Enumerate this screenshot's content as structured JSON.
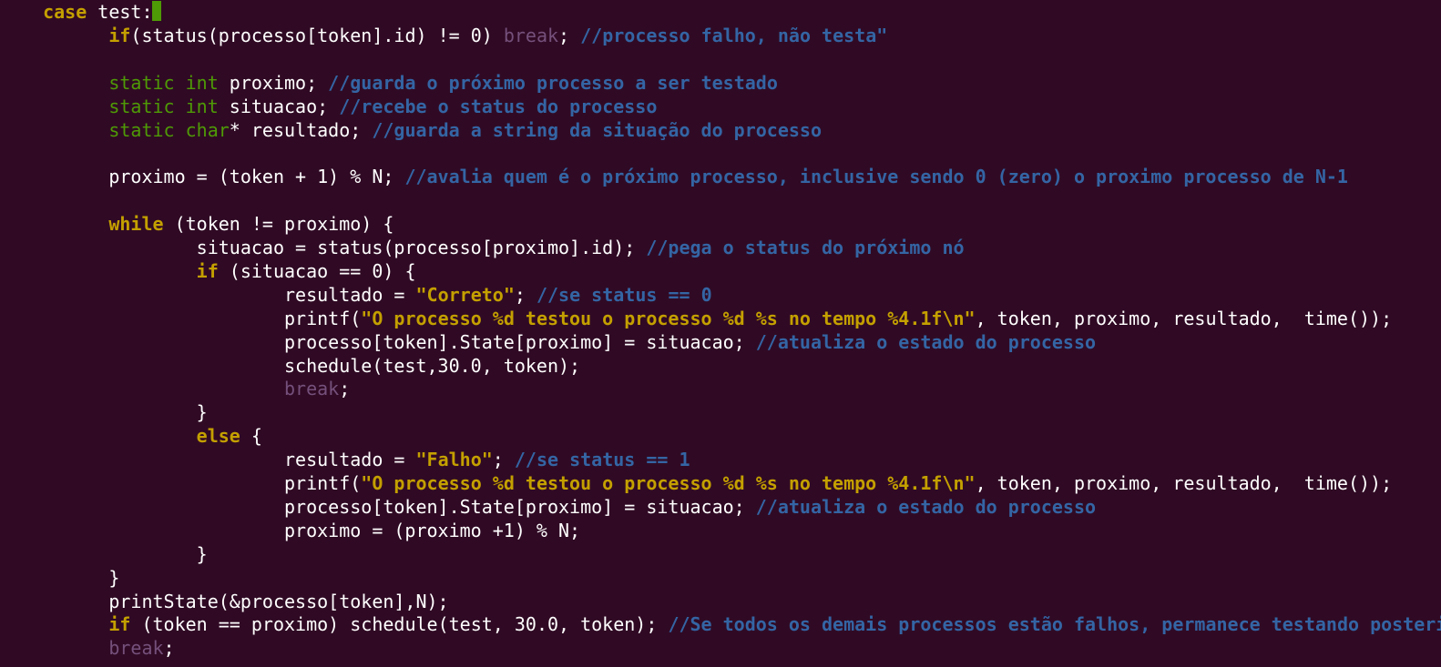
{
  "editor": {
    "lines": [
      {
        "tokens": [
          {
            "type": "plain",
            "text": "  "
          },
          {
            "type": "keyword",
            "text": "case"
          },
          {
            "type": "plain",
            "text": " test:"
          }
        ]
      },
      {
        "tokens": [
          {
            "type": "plain",
            "text": "        "
          },
          {
            "type": "keyword",
            "text": "if"
          },
          {
            "type": "plain",
            "text": "(status(processo[token].id) != 0) "
          },
          {
            "type": "break",
            "text": "break"
          },
          {
            "type": "plain",
            "text": "; "
          },
          {
            "type": "comment",
            "text": "//processo falho, não testa\""
          }
        ]
      },
      {
        "tokens": []
      },
      {
        "tokens": [
          {
            "type": "plain",
            "text": "        "
          },
          {
            "type": "type",
            "text": "static int"
          },
          {
            "type": "plain",
            "text": " proximo; "
          },
          {
            "type": "comment",
            "text": "//guarda o próximo processo a ser testado"
          }
        ]
      },
      {
        "tokens": [
          {
            "type": "plain",
            "text": "        "
          },
          {
            "type": "type",
            "text": "static int"
          },
          {
            "type": "plain",
            "text": " situacao; "
          },
          {
            "type": "comment",
            "text": "//recebe o status do processo"
          }
        ]
      },
      {
        "tokens": [
          {
            "type": "plain",
            "text": "        "
          },
          {
            "type": "type",
            "text": "static char"
          },
          {
            "type": "plain",
            "text": "* resultado; "
          },
          {
            "type": "comment",
            "text": "//guarda a string da situação do processo"
          }
        ]
      },
      {
        "tokens": []
      },
      {
        "tokens": [
          {
            "type": "plain",
            "text": "        proximo = (token + 1) % N; "
          },
          {
            "type": "comment",
            "text": "//avalia quem é o próximo processo, inclusive sendo 0 (zero) o proximo processo de N-1"
          }
        ]
      },
      {
        "tokens": []
      },
      {
        "tokens": [
          {
            "type": "plain",
            "text": "        "
          },
          {
            "type": "keyword",
            "text": "while"
          },
          {
            "type": "plain",
            "text": " (token != proximo) {"
          }
        ]
      },
      {
        "tokens": [
          {
            "type": "plain",
            "text": "                situacao = status(processo[proximo].id); "
          },
          {
            "type": "comment",
            "text": "//pega o status do próximo nó"
          }
        ]
      },
      {
        "tokens": [
          {
            "type": "plain",
            "text": "                "
          },
          {
            "type": "keyword",
            "text": "if"
          },
          {
            "type": "plain",
            "text": " (situacao == 0) {"
          }
        ]
      },
      {
        "tokens": [
          {
            "type": "plain",
            "text": "                        resultado = "
          },
          {
            "type": "string",
            "text": "\"Correto\""
          },
          {
            "type": "plain",
            "text": "; "
          },
          {
            "type": "comment",
            "text": "//se status == 0"
          }
        ]
      },
      {
        "tokens": [
          {
            "type": "plain",
            "text": "                        printf("
          },
          {
            "type": "string",
            "text": "\"O processo %d testou o processo %d %s no tempo %4.1f\\n\""
          },
          {
            "type": "plain",
            "text": ", token, proximo, resultado,  time());"
          }
        ]
      },
      {
        "tokens": [
          {
            "type": "plain",
            "text": "                        processo[token].State[proximo] = situacao; "
          },
          {
            "type": "comment",
            "text": "//atualiza o estado do processo"
          }
        ]
      },
      {
        "tokens": [
          {
            "type": "plain",
            "text": "                        schedule(test,30.0, token);"
          }
        ]
      },
      {
        "tokens": [
          {
            "type": "plain",
            "text": "                        "
          },
          {
            "type": "break",
            "text": "break"
          },
          {
            "type": "plain",
            "text": ";"
          }
        ]
      },
      {
        "tokens": [
          {
            "type": "plain",
            "text": "                }"
          }
        ]
      },
      {
        "tokens": [
          {
            "type": "plain",
            "text": "                "
          },
          {
            "type": "keyword",
            "text": "else"
          },
          {
            "type": "plain",
            "text": " {"
          }
        ]
      },
      {
        "tokens": [
          {
            "type": "plain",
            "text": "                        resultado = "
          },
          {
            "type": "string",
            "text": "\"Falho\""
          },
          {
            "type": "plain",
            "text": "; "
          },
          {
            "type": "comment",
            "text": "//se status == 1"
          }
        ]
      },
      {
        "tokens": [
          {
            "type": "plain",
            "text": "                        printf("
          },
          {
            "type": "string",
            "text": "\"O processo %d testou o processo %d %s no tempo %4.1f\\n\""
          },
          {
            "type": "plain",
            "text": ", token, proximo, resultado,  time());"
          }
        ]
      },
      {
        "tokens": [
          {
            "type": "plain",
            "text": "                        processo[token].State[proximo] = situacao; "
          },
          {
            "type": "comment",
            "text": "//atualiza o estado do processo"
          }
        ]
      },
      {
        "tokens": [
          {
            "type": "plain",
            "text": "                        proximo = (proximo +1) % N;"
          }
        ]
      },
      {
        "tokens": [
          {
            "type": "plain",
            "text": "                }"
          }
        ]
      },
      {
        "tokens": [
          {
            "type": "plain",
            "text": "        }"
          }
        ]
      },
      {
        "tokens": [
          {
            "type": "plain",
            "text": "        printState(&processo[token],N);"
          }
        ]
      },
      {
        "tokens": [
          {
            "type": "plain",
            "text": "        "
          },
          {
            "type": "keyword",
            "text": "if"
          },
          {
            "type": "plain",
            "text": " (token == proximo) schedule(test, 30.0, token); "
          },
          {
            "type": "comment",
            "text": "//Se todos os demais processos estão falhos, permanece testando posterior"
          }
        ]
      },
      {
        "tokens": [
          {
            "type": "plain",
            "text": "        "
          },
          {
            "type": "break",
            "text": "break"
          },
          {
            "type": "plain",
            "text": ";"
          }
        ]
      }
    ]
  },
  "colors": {
    "background": "#300a24",
    "plain": "#ffffff",
    "keyword": "#c4a000",
    "type": "#4e9a06",
    "break": "#75507b",
    "comment": "#3465a4",
    "string": "#c4a000",
    "cursor": "#4e9a06"
  }
}
